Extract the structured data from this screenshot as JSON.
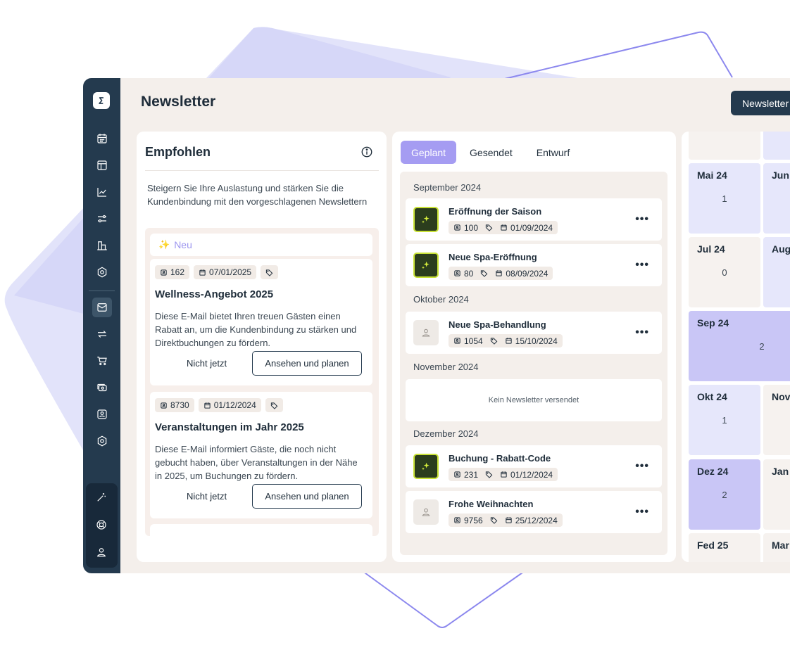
{
  "page": {
    "title": "Newsletter",
    "new_button": "Newsletter"
  },
  "sidebar": {
    "items": [
      {
        "icon": "calendar-icon"
      },
      {
        "icon": "layout-icon"
      },
      {
        "icon": "chart-icon"
      },
      {
        "icon": "sliders-icon"
      },
      {
        "icon": "building-icon"
      },
      {
        "icon": "settings-icon"
      },
      {
        "icon": "mail-icon",
        "active": true
      },
      {
        "icon": "repeat-icon"
      },
      {
        "icon": "cart-icon"
      },
      {
        "icon": "cash-icon"
      },
      {
        "icon": "contact-icon"
      },
      {
        "icon": "settings-icon"
      }
    ],
    "bottom": [
      {
        "icon": "magic-wand-icon"
      },
      {
        "icon": "lifebuoy-icon"
      },
      {
        "icon": "user-icon"
      }
    ]
  },
  "recommended": {
    "title": "Empfohlen",
    "intro": "Steigern Sie Ihre Auslastung und stärken Sie die Kundenbindung mit den vorgeschlagenen Newslettern",
    "new_label": "Neu",
    "items": [
      {
        "contacts": "162",
        "date": "07/01/2025",
        "title": "Wellness-Angebot 2025",
        "description": "Diese E-Mail bietet Ihren treuen Gästen einen Rabatt an, um die Kundenbindung zu stärken und Direktbuchungen zu fördern.",
        "later_label": "Nicht jetzt",
        "plan_label": "Ansehen und planen"
      },
      {
        "contacts": "8730",
        "date": "01/12/2024",
        "title": "Veranstaltungen im Jahr 2025",
        "description": "Diese E-Mail informiert Gäste, die noch nicht gebucht haben, über Veranstaltungen in der Nähe in 2025, um Buchungen zu fördern.",
        "later_label": "Nicht jetzt",
        "plan_label": "Ansehen und planen"
      }
    ]
  },
  "tabs": [
    {
      "label": "Geplant",
      "active": true
    },
    {
      "label": "Gesendet",
      "active": false
    },
    {
      "label": "Entwurf",
      "active": false
    }
  ],
  "schedule": {
    "months": [
      {
        "label": "September 2024"
      },
      {
        "label": "Oktober 2024"
      },
      {
        "label": "November 2024"
      },
      {
        "label": "Dezember 2024"
      }
    ],
    "newsletters": [
      {
        "title": "Eröffnung der Saison",
        "contacts": "100",
        "date": "01/09/2024",
        "thumb": "spark"
      },
      {
        "title": "Neue Spa-Eröffnung",
        "contacts": "80",
        "date": "08/09/2024",
        "thumb": "spark"
      },
      {
        "title": "Neue Spa-Behandlung",
        "contacts": "1054",
        "date": "15/10/2024",
        "thumb": "plain"
      },
      {
        "title": "Buchung - Rabatt-Code",
        "contacts": "231",
        "date": "01/12/2024",
        "thumb": "spark"
      },
      {
        "title": "Frohe Weihnachten",
        "contacts": "9756",
        "date": "25/12/2024",
        "thumb": "plain"
      }
    ],
    "empty_label": "Kein Newsletter versendet"
  },
  "calendar": {
    "cells": [
      {
        "month": "Mai 24",
        "count": "1"
      },
      {
        "month": "Jun",
        "count": ""
      },
      {
        "month": "Jul 24",
        "count": "0"
      },
      {
        "month": "Aug",
        "count": ""
      },
      {
        "month": "Sep 24",
        "count": "2"
      },
      {
        "month": "Okt 24",
        "count": "1"
      },
      {
        "month": "Nov",
        "count": ""
      },
      {
        "month": "Dez 24",
        "count": "2"
      },
      {
        "month": "Jan",
        "count": ""
      },
      {
        "month": "Fed 25",
        "count": ""
      },
      {
        "month": "Mar",
        "count": ""
      }
    ]
  },
  "colors": {
    "sidebar": "#243a4e",
    "accent": "#a59cf2",
    "background": "#f4efeb",
    "spark_border": "#c9e236"
  }
}
